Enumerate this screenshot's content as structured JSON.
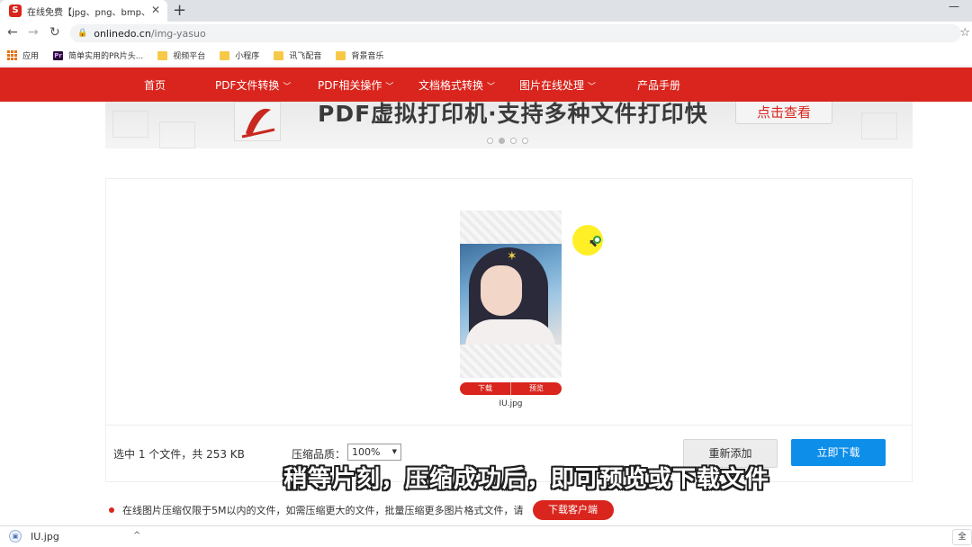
{
  "browser": {
    "tab_title": "在线免费【jpg、png、bmp、g",
    "url_host": "onlinedo.cn",
    "url_path": "/img-yasuo",
    "bookmarks": [
      "应用",
      "简单实用的PR片头...",
      "视频平台",
      "小程序",
      "讯飞配音",
      "背景音乐"
    ]
  },
  "sitenav": {
    "items": [
      "首页",
      "PDF文件转换",
      "PDF相关操作",
      "文档格式转换",
      "图片在线处理",
      "产品手册"
    ]
  },
  "banner": {
    "title": "PDF虚拟打印机·支持多种文件打印快",
    "button": "点击查看"
  },
  "file_card": {
    "download_label": "下载",
    "preview_label": "预览",
    "file_name": "IU.jpg"
  },
  "toolbar": {
    "selection_summary": "选中 1 个文件，共 253 KB",
    "quality_label": "压缩品质：",
    "quality_value": "100%",
    "readd_label": "重新添加",
    "download_label": "立即下载"
  },
  "notice": {
    "text": "在线图片压缩仅限于5M以内的文件，如需压缩更大的文件，批量压缩更多图片格式文件，请",
    "button": "下载客户端"
  },
  "subtitle": "稍等片刻，压缩成功后，即可预览或下载文件",
  "download_shelf": {
    "file_name": "IU.jpg",
    "show_all": "全"
  },
  "colors": {
    "brand_red": "#d9251d",
    "download_blue": "#0d8ee9",
    "cursor_highlight": "#ffec00"
  }
}
